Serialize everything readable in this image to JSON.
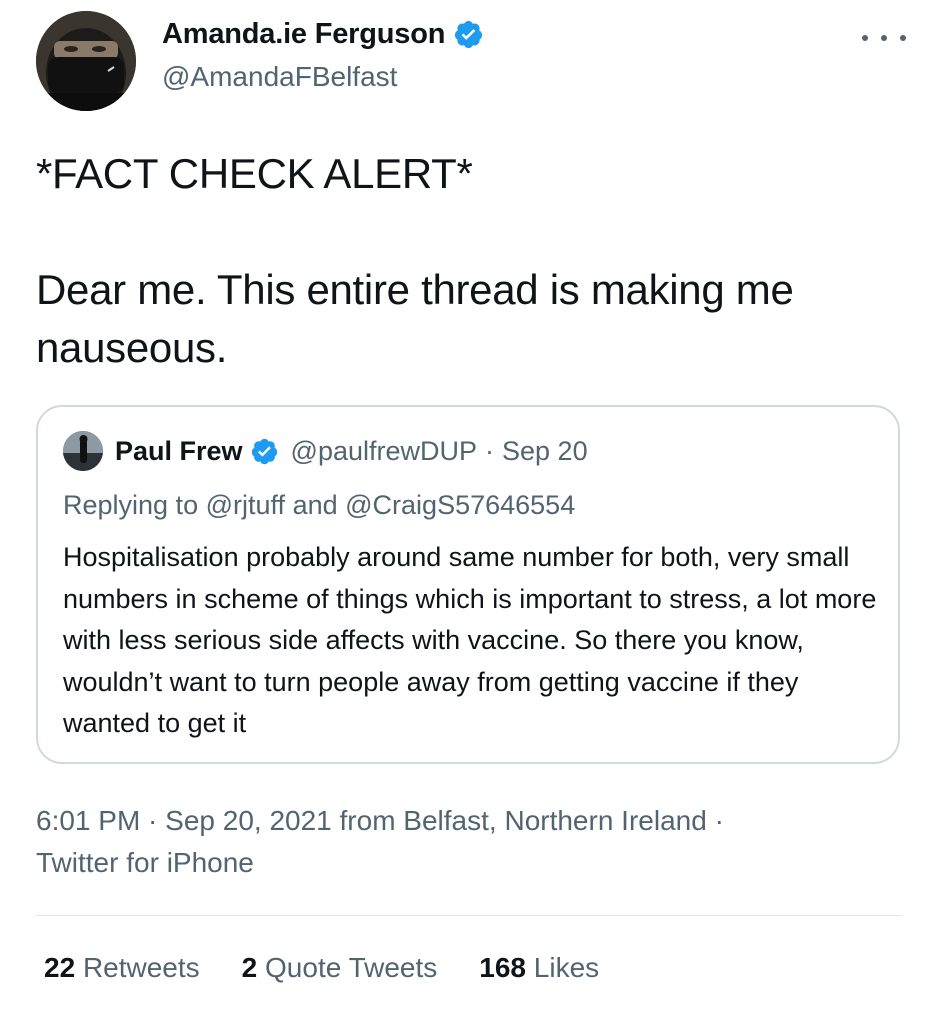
{
  "tweet": {
    "author": {
      "name": "Amanda.ie Ferguson",
      "handle": "@AmandaFBelfast",
      "verified": true
    },
    "text": "*FACT CHECK ALERT*\n\nDear me. This entire thread is making me nauseous.",
    "quoted": {
      "author_name": "Paul Frew",
      "author_handle": "@paulfrewDUP",
      "separator": "·",
      "date": "Sep 20",
      "replying_prefix": "Replying to",
      "replying_user1": "@rjtuff",
      "replying_and": "and",
      "replying_user2": "@CraigS57646554",
      "body": "Hospitalisation probably around same number for both, very small numbers in scheme of things which is important to stress, a lot more with less serious side affects with vaccine. So there you know, wouldn’t want to turn people away from getting vaccine if they wanted to get it"
    },
    "meta": "6:01 PM · Sep 20, 2021 from Belfast, Northern Ireland · Twitter for iPhone",
    "stats": {
      "retweets_count": "22",
      "retweets_label": "Retweets",
      "quote_count": "2",
      "quote_label": "Quote Tweets",
      "likes_count": "168",
      "likes_label": "Likes"
    }
  },
  "icons": {
    "verified": "verified-badge-icon",
    "more": "more-options-icon"
  },
  "colors": {
    "verified_blue": "#1d9bf0",
    "secondary_text": "#536471",
    "primary_text": "#0f1419",
    "border": "#cfd9de"
  }
}
